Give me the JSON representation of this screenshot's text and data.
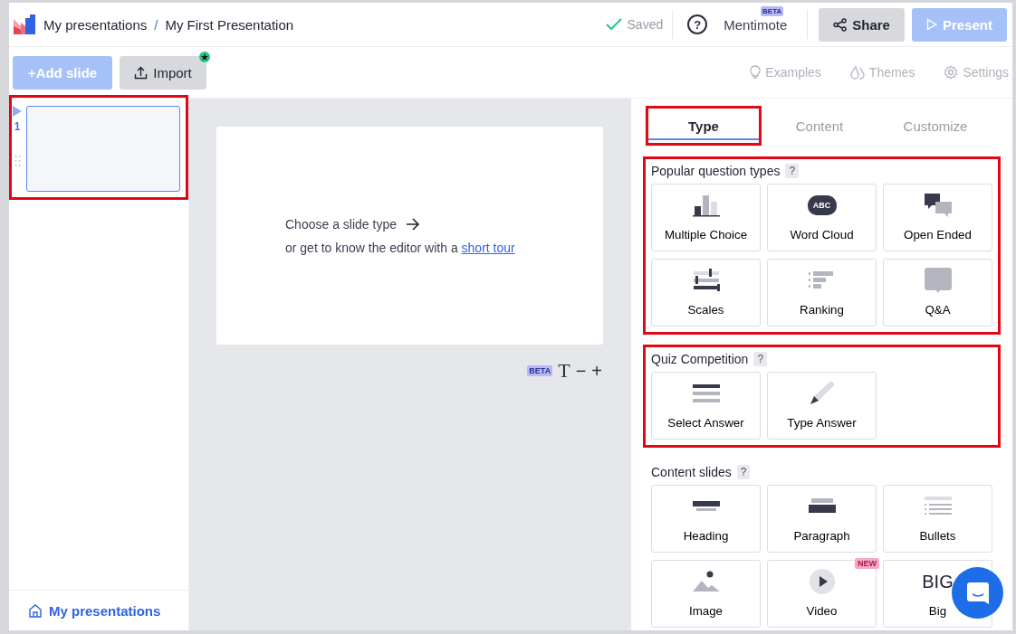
{
  "header": {
    "breadcrumb": [
      {
        "label": "My presentations"
      },
      {
        "label": "My First Presentation"
      }
    ],
    "separator": "/",
    "status": "Saved",
    "help": "?",
    "mentimote": {
      "label": "Mentimote",
      "badge": "BETA"
    },
    "buttons": [
      {
        "label": "Share",
        "kind": "secondary"
      },
      {
        "label": "Present",
        "kind": "primary"
      }
    ]
  },
  "toolbar": {
    "add_slide": {
      "icon": "+",
      "label": "Add slide"
    },
    "import": {
      "label": "Import",
      "new_dot": true
    },
    "links": [
      {
        "label": "Examples",
        "kind": "bulb"
      },
      {
        "label": "Themes",
        "kind": "drop"
      },
      {
        "label": "Settings",
        "kind": "gear"
      }
    ]
  },
  "sidebar": {
    "slides": [
      {
        "number": "1",
        "selected": true,
        "highlighted": true
      }
    ],
    "footer_link": "My presentations"
  },
  "canvas": {
    "prompt": "Choose a slide type",
    "hint": "or get to know the editor with a",
    "link": "short tour",
    "zoom": {
      "badge": "BETA",
      "text_icon": "T",
      "minus": "−",
      "plus": "+"
    }
  },
  "panel": {
    "tabs": [
      {
        "label": "Type",
        "selected": true,
        "highlighted": true
      },
      {
        "label": "Content",
        "selected": false,
        "highlighted": false
      },
      {
        "label": "Customize",
        "selected": false,
        "highlighted": false
      }
    ],
    "sections": [
      {
        "title": "Popular question types",
        "help": "?",
        "highlighted": true,
        "cards": [
          {
            "label": "Multiple Choice",
            "kind": "bars"
          },
          {
            "label": "Word Cloud",
            "kind": "cloud",
            "icon_text": "ABC"
          },
          {
            "label": "Open Ended",
            "kind": "bubbles"
          },
          {
            "label": "Scales",
            "kind": "scales"
          },
          {
            "label": "Ranking",
            "kind": "ranking"
          },
          {
            "label": "Q&A",
            "kind": "qa"
          }
        ]
      },
      {
        "title": "Quiz Competition",
        "help": "?",
        "highlighted": true,
        "cards": [
          {
            "label": "Select Answer",
            "kind": "lines"
          },
          {
            "label": "Type Answer",
            "kind": "pencil"
          }
        ]
      },
      {
        "title": "Content slides",
        "help": "?",
        "highlighted": false,
        "cards": [
          {
            "label": "Heading",
            "kind": "heading"
          },
          {
            "label": "Paragraph",
            "kind": "paragraph"
          },
          {
            "label": "Bullets",
            "kind": "bullets"
          },
          {
            "label": "Image",
            "kind": "image"
          },
          {
            "label": "Video",
            "kind": "video",
            "badge": "NEW"
          },
          {
            "label": "Big",
            "kind": "big",
            "icon_text": "BIG"
          }
        ]
      }
    ]
  }
}
